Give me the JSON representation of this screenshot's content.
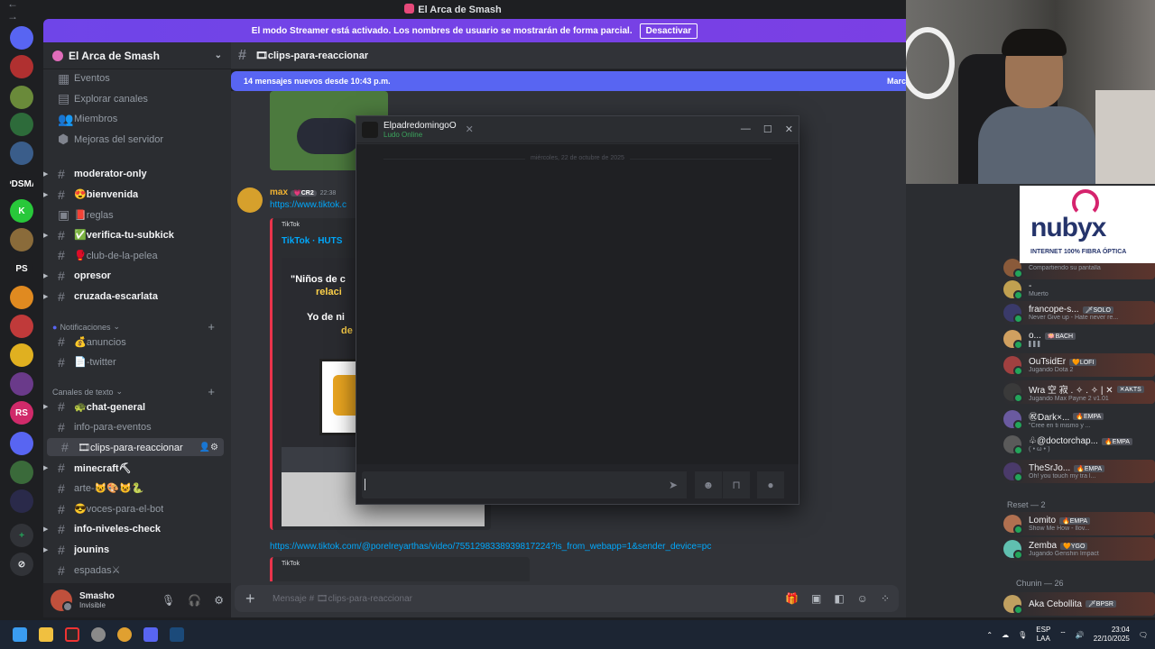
{
  "window": {
    "title": "El Arca de Smash",
    "nav": "← →"
  },
  "streamer_banner": {
    "text": "El modo Streamer está activado. Los nombres de usuario se mostrarán de forma parcial.",
    "button": "Desactivar"
  },
  "guild_rail": {
    "items": [
      {
        "label": "",
        "color": "#5865f2",
        "icon": "discord-icon"
      },
      {
        "label": "",
        "color": "#b03030"
      },
      {
        "label": "",
        "color": "#6a8a3a"
      },
      {
        "label": "",
        "color": "#2d6b3a"
      },
      {
        "label": "",
        "color": "#3a5d8a"
      },
      {
        "label": "PDSMA",
        "color": "#1e1f22"
      },
      {
        "label": "K",
        "color": "#28c83a"
      },
      {
        "label": "",
        "color": "#8a6b3a"
      },
      {
        "label": "PS",
        "color": "#1e1f22"
      },
      {
        "label": "",
        "color": "#e08a20"
      },
      {
        "label": "",
        "color": "#c03a3a"
      },
      {
        "label": "",
        "color": "#e0b020"
      },
      {
        "label": "",
        "color": "#6a3a8a"
      },
      {
        "label": "RS",
        "color": "#d02a6a"
      },
      {
        "label": "",
        "color": "#5865f2"
      },
      {
        "label": "",
        "color": "#3a6a3a"
      },
      {
        "label": "",
        "color": "#2a2a4a"
      }
    ],
    "add": "+",
    "explore": "⊘"
  },
  "sidebar": {
    "server_name": "El Arca de Smash",
    "top_items": [
      {
        "label": "Eventos",
        "icon": "calendar-icon"
      },
      {
        "label": "Explorar canales",
        "icon": "explore-icon"
      },
      {
        "label": "Miembros",
        "icon": "members-icon"
      },
      {
        "label": "Mejoras del servidor",
        "icon": "boost-icon"
      }
    ],
    "channels_a": [
      {
        "label": "moderator-only",
        "unread": true,
        "arrow": true
      },
      {
        "label": "😍bienvenida",
        "unread": true,
        "arrow": true
      },
      {
        "label": "📕reglas",
        "unread": false,
        "arrow": false,
        "icon": "rules-icon"
      },
      {
        "label": "✅verifica-tu-subkick",
        "unread": true,
        "arrow": true
      },
      {
        "label": "🥊club-de-la-pelea",
        "unread": false,
        "arrow": false
      },
      {
        "label": "opresor",
        "unread": true,
        "arrow": true
      },
      {
        "label": "cruzada-escarlata",
        "unread": true,
        "arrow": true
      }
    ],
    "cat_notifications": "Notificaciones",
    "channels_b": [
      {
        "label": "💰anuncios"
      },
      {
        "label": "📄-twitter"
      }
    ],
    "cat_text": "Canales de texto",
    "channels_c": [
      {
        "label": "🐢chat-general",
        "unread": true,
        "arrow": true
      },
      {
        "label": "info-para-eventos",
        "unread": false,
        "arrow": false
      },
      {
        "label": "🎞clips-para-reaccionar",
        "unread": false,
        "arrow": false,
        "active": true
      },
      {
        "label": "minecraft⛏",
        "unread": true,
        "arrow": true
      },
      {
        "label": "arte-😺🎨😺🐍",
        "unread": false,
        "arrow": false
      },
      {
        "label": "😎voces-para-el-bot",
        "unread": false,
        "arrow": false
      },
      {
        "label": "info-niveles-check",
        "unread": true,
        "arrow": true
      },
      {
        "label": "jounins",
        "unread": true,
        "arrow": true
      },
      {
        "label": "espadas⚔",
        "unread": false,
        "arrow": false
      }
    ],
    "user": {
      "name": "Smasho",
      "status": "Invisible"
    }
  },
  "chat": {
    "channel": "🎞clips-para-reaccionar",
    "new_messages": "14 mensajes nuevos desde 10:43 p.m.",
    "new_messages_mark": "Marc",
    "message": {
      "author": "max",
      "badge": "💗CR2",
      "time": "22:38",
      "link1": "https://www.tiktok.c",
      "embed_provider": "TikTok",
      "embed_title": "TikTok · HUTS",
      "video_text1": "\"Niños de c",
      "video_text2": "relaci",
      "video_text3": "Yo de ni",
      "video_text4": "de",
      "link2": "https://www.tiktok.com/@porelreyarthas/video/7551298338939817224?is_from_webapp=1&sender_device=pc",
      "embed2_provider": "TikTok"
    },
    "composer_placeholder": "Mensaje # 🎞clips-para-reaccionar"
  },
  "popout": {
    "name": "ElpadredomingoO",
    "subtitle": "Ludo Online",
    "date": "miércoles, 22 de octubre de 2025"
  },
  "ad": {
    "logo": "nubyx",
    "tagline": "INTERNET 100% FIBRA ÓPTICA"
  },
  "members": [
    {
      "name": "",
      "status": "Compartiendo su pantalla",
      "badge": "",
      "color": "#8a5a3a"
    },
    {
      "name": "-",
      "status": "Muerto",
      "badge": "",
      "color": "#c0a050"
    },
    {
      "name": "francope-s...",
      "status": "Never Give up - Hate never re...",
      "badge": "🗡SOLO",
      "color": "#3a3a6a"
    },
    {
      "name": "o...",
      "status": "▌▌▌",
      "badge": "🪷BACH",
      "color": "#d0a060"
    },
    {
      "name": "OuTsidEr",
      "status": "Jugando Dota 2",
      "badge": "🧡LOFI",
      "color": "#a04040"
    },
    {
      "name": "Wra 空 寂 . ✧ . ✧ | ✕",
      "status": "Jugando Max Payne 2 v1.01",
      "badge": "✕AKTS",
      "color": "#3a3a3a"
    },
    {
      "name": "㊗Dark×...",
      "status": "\"Cree en ti mismo y ...",
      "badge": "🔥EMPA",
      "color": "#6a5aa0"
    },
    {
      "name": "♧@doctorchap...",
      "status": "(´• ω •`)",
      "badge": "🔥EMPA",
      "color": "#5a5a5a"
    },
    {
      "name": "TheSrJo...",
      "status": "Oh! you touch my tra l...",
      "badge": "🔥EMPA",
      "color": "#4a3a6a"
    }
  ],
  "group_reset": "Reset — 2",
  "members_reset": [
    {
      "name": "Lomito",
      "status": "Show Me How - Ilov...",
      "badge": "🔥EMPA",
      "color": "#b07050"
    },
    {
      "name": "Zemba",
      "status": "Jugando Genshin Impact",
      "badge": "🧡YGO",
      "color": "#60c0b0"
    }
  ],
  "group_chunin": "Chunin — 26",
  "members_chunin": [
    {
      "name": "Aka Cebollita",
      "status": "",
      "badge": "🗡BPSR",
      "color": "#c0a060"
    }
  ],
  "taskbar": {
    "apps": [
      "windows-start-icon",
      "file-explorer-icon",
      "kick-icon",
      "settings-icon",
      "chrome-icon",
      "discord-icon",
      "steam-icon"
    ],
    "lang1": "ESP",
    "lang2": "LAA",
    "time": "23:04",
    "date": "22/10/2025"
  }
}
